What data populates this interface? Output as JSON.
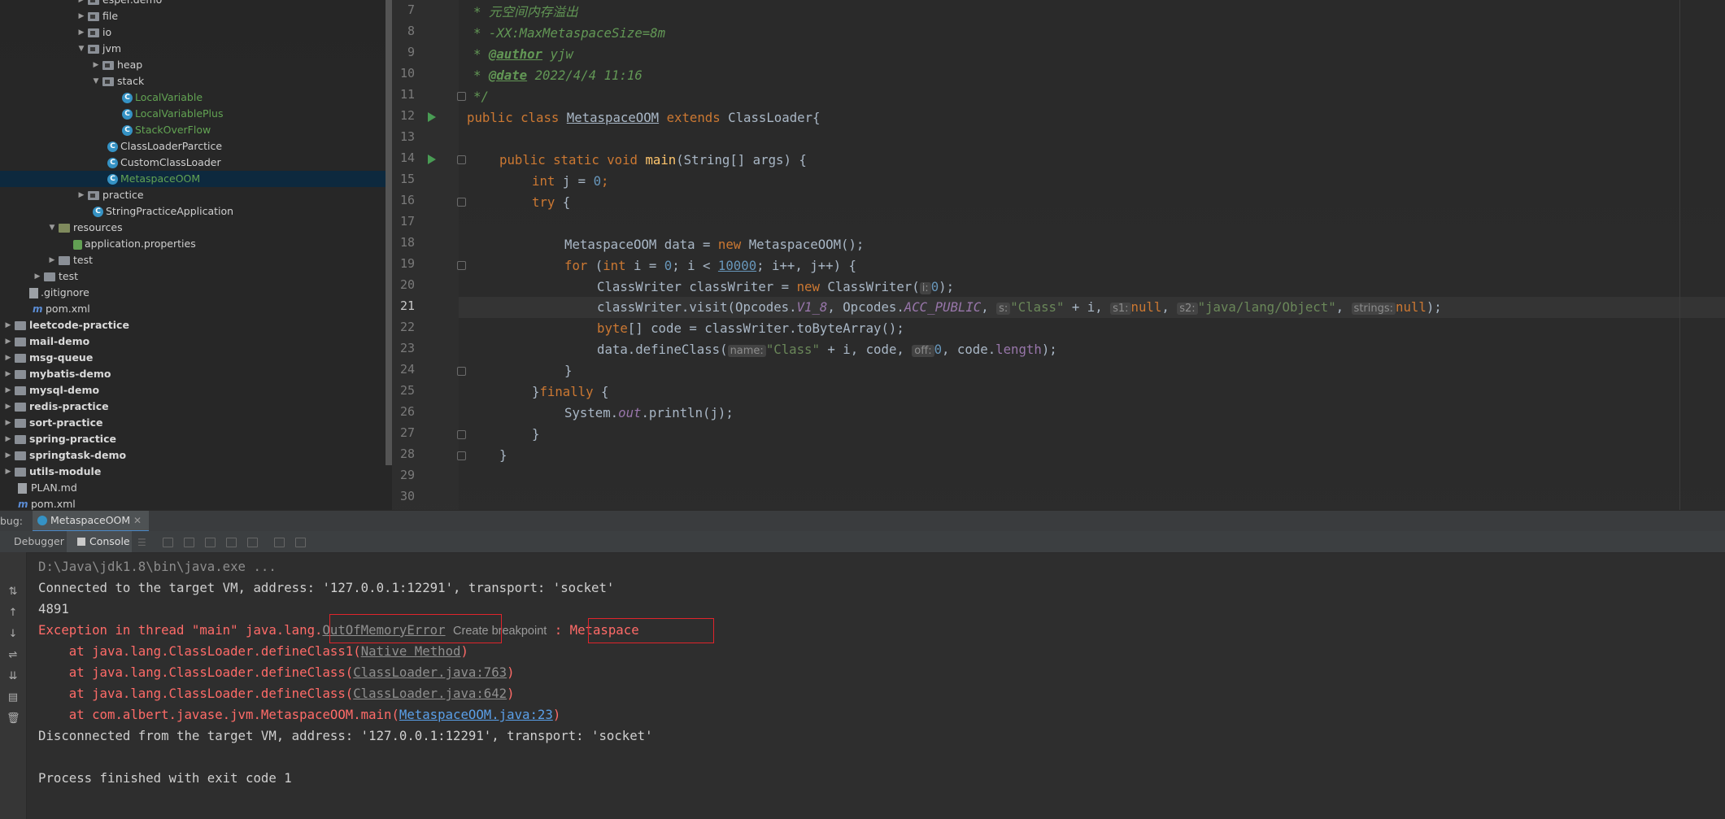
{
  "tree": {
    "items": [
      {
        "label": "esper.demo",
        "kind": "pkg",
        "level": 5
      },
      {
        "label": "file",
        "kind": "pkg",
        "level": 5
      },
      {
        "label": "io",
        "kind": "pkg",
        "level": 5
      },
      {
        "label": "jvm",
        "kind": "pkg",
        "level": 5,
        "expanded": true
      },
      {
        "label": "heap",
        "kind": "pkg",
        "level": 6
      },
      {
        "label": "stack",
        "kind": "pkg",
        "level": 6,
        "expanded": true
      },
      {
        "label": "LocalVariable",
        "kind": "class",
        "level": 7,
        "green": true
      },
      {
        "label": "LocalVariablePlus",
        "kind": "class",
        "level": 7,
        "green": true
      },
      {
        "label": "StackOverFlow",
        "kind": "class",
        "level": 7,
        "green": true
      },
      {
        "label": "ClassLoaderParctice",
        "kind": "class",
        "level": 6
      },
      {
        "label": "CustomClassLoader",
        "kind": "class",
        "level": 6
      },
      {
        "label": "MetaspaceOOM",
        "kind": "class",
        "level": 6,
        "green": true,
        "selected": true
      },
      {
        "label": "practice",
        "kind": "pkg",
        "level": 5
      },
      {
        "label": "StringPracticeApplication",
        "kind": "class",
        "level": 5
      },
      {
        "label": "resources",
        "kind": "res",
        "level": 3,
        "expanded": true
      },
      {
        "label": "application.properties",
        "kind": "prop",
        "level": 4
      },
      {
        "label": "test",
        "kind": "folder",
        "level": 3
      },
      {
        "label": "test",
        "kind": "folder",
        "level": 2
      },
      {
        "label": ".gitignore",
        "kind": "txt",
        "level": 1
      },
      {
        "label": "pom.xml",
        "kind": "mvn",
        "level": 1
      },
      {
        "label": "leetcode-practice",
        "kind": "module",
        "level": 0
      },
      {
        "label": "mail-demo",
        "kind": "module",
        "level": 0
      },
      {
        "label": "msg-queue",
        "kind": "module",
        "level": 0
      },
      {
        "label": "mybatis-demo",
        "kind": "module",
        "level": 0
      },
      {
        "label": "mysql-demo",
        "kind": "module",
        "level": 0
      },
      {
        "label": "redis-practice",
        "kind": "module",
        "level": 0
      },
      {
        "label": "sort-practice",
        "kind": "module",
        "level": 0
      },
      {
        "label": "spring-practice",
        "kind": "module",
        "level": 0
      },
      {
        "label": "springtask-demo",
        "kind": "module",
        "level": 0
      },
      {
        "label": "utils-module",
        "kind": "module",
        "level": 0
      },
      {
        "label": "PLAN.md",
        "kind": "md",
        "level": 0
      },
      {
        "label": "pom.xml",
        "kind": "mvn",
        "level": 0
      }
    ]
  },
  "editor": {
    "line_numbers": [
      "7",
      "8",
      "9",
      "10",
      "11",
      "12",
      "13",
      "14",
      "15",
      "16",
      "17",
      "18",
      "19",
      "20",
      "21",
      "22",
      "23",
      "24",
      "25",
      "26",
      "27",
      "28",
      "29",
      "30"
    ],
    "current_line": "21",
    "code": {
      "l7": "* 元空间内存溢出",
      "l8": "* -XX:MaxMetaspaceSize=8m",
      "l9_tag": "@author",
      "l9_rest": " yjw",
      "l10_tag": "@date",
      "l10_rest": " 2022/4/4 11:16",
      "l11": "*/",
      "l12_kw": "public class ",
      "l12_name": "MetaspaceOOM",
      "l12_kw2": " extends ",
      "l12_rest": "ClassLoader{",
      "l14_kw": "public static void ",
      "l14_fn": "main",
      "l14_rest": "(String[] args) {",
      "l15_kw": "int ",
      "l15_rest": "j = ",
      "l15_num": "0",
      "l16_kw": "try ",
      "l18_a": "MetaspaceOOM data = ",
      "l18_kw": "new ",
      "l18_b": "MetaspaceOOM();",
      "l19_kw": "for ",
      "l19_a": "(",
      "l19_kw2": "int ",
      "l19_b": "i = ",
      "l19_n0": "0",
      "l19_c": "; i < ",
      "l19_n1": "10000",
      "l19_d": "; i++, j++) {",
      "l20_a": "ClassWriter classWriter = ",
      "l20_kw": "new ",
      "l20_b": "ClassWriter(",
      "l20_hint": "i:",
      "l20_num": "0",
      "l20_c": ");",
      "l21_a": "classWriter.visit(Opcodes.",
      "l21_f1": "V1_8",
      "l21_b": ", Opcodes.",
      "l21_f2": "ACC_PUBLIC",
      "l21_h1": "s:",
      "l21_s1": "\"Class\"",
      "l21_c": " + i, ",
      "l21_h2": "s1:",
      "l21_null1": "null",
      "l21_h3": "s2:",
      "l21_s2": "\"java/lang/Object\"",
      "l21_h4": "strings:",
      "l21_null2": "null",
      "l22_a": "byte",
      "l22_b": "[] code = classWriter.toByteArray();",
      "l23_a": "data.defineClass(",
      "l23_h1": "name:",
      "l23_s": "\"Class\"",
      "l23_b": " + i, code, ",
      "l23_h2": "off:",
      "l23_num": "0",
      "l23_c": ", code.",
      "l23_fld": "length",
      "l23_d": ");",
      "l24": "}",
      "l25_a": "}",
      "l25_kw": "finally ",
      "l25_b": "{",
      "l26_a": "System.",
      "l26_fld": "out",
      "l26_b": ".println(j);",
      "l27": "}",
      "l28": "}"
    }
  },
  "debug": {
    "label": "bug:",
    "run_tab": "MetaspaceOOM",
    "tab_debugger": "Debugger",
    "tab_console": "Console"
  },
  "console": {
    "l1": "D:\\Java\\jdk1.8\\bin\\java.exe ...",
    "l2": "Connected to the target VM, address: '127.0.0.1:12291', transport: 'socket'",
    "l3": "4891",
    "l4_a": "Exception in thread \"main\" java.lang.",
    "l4_err": "OutOfMemoryError",
    "l4_bp": "Create breakpoint",
    "l4_b": " : Metaspace",
    "l5_a": "    at java.lang.ClassLoader.defineClass1(",
    "l5_link": "Native Method",
    "l5_b": ")",
    "l6_a": "    at java.lang.ClassLoader.defineClass(",
    "l6_link": "ClassLoader.java:763",
    "l6_b": ")",
    "l7_a": "    at java.lang.ClassLoader.defineClass(",
    "l7_link": "ClassLoader.java:642",
    "l7_b": ")",
    "l8_a": "    at com.albert.javase.jvm.MetaspaceOOM.main(",
    "l8_link": "MetaspaceOOM.java:23",
    "l8_b": ")",
    "l9": "Disconnected from the target VM, address: '127.0.0.1:12291', transport: 'socket'",
    "l11": "Process finished with exit code 1"
  }
}
